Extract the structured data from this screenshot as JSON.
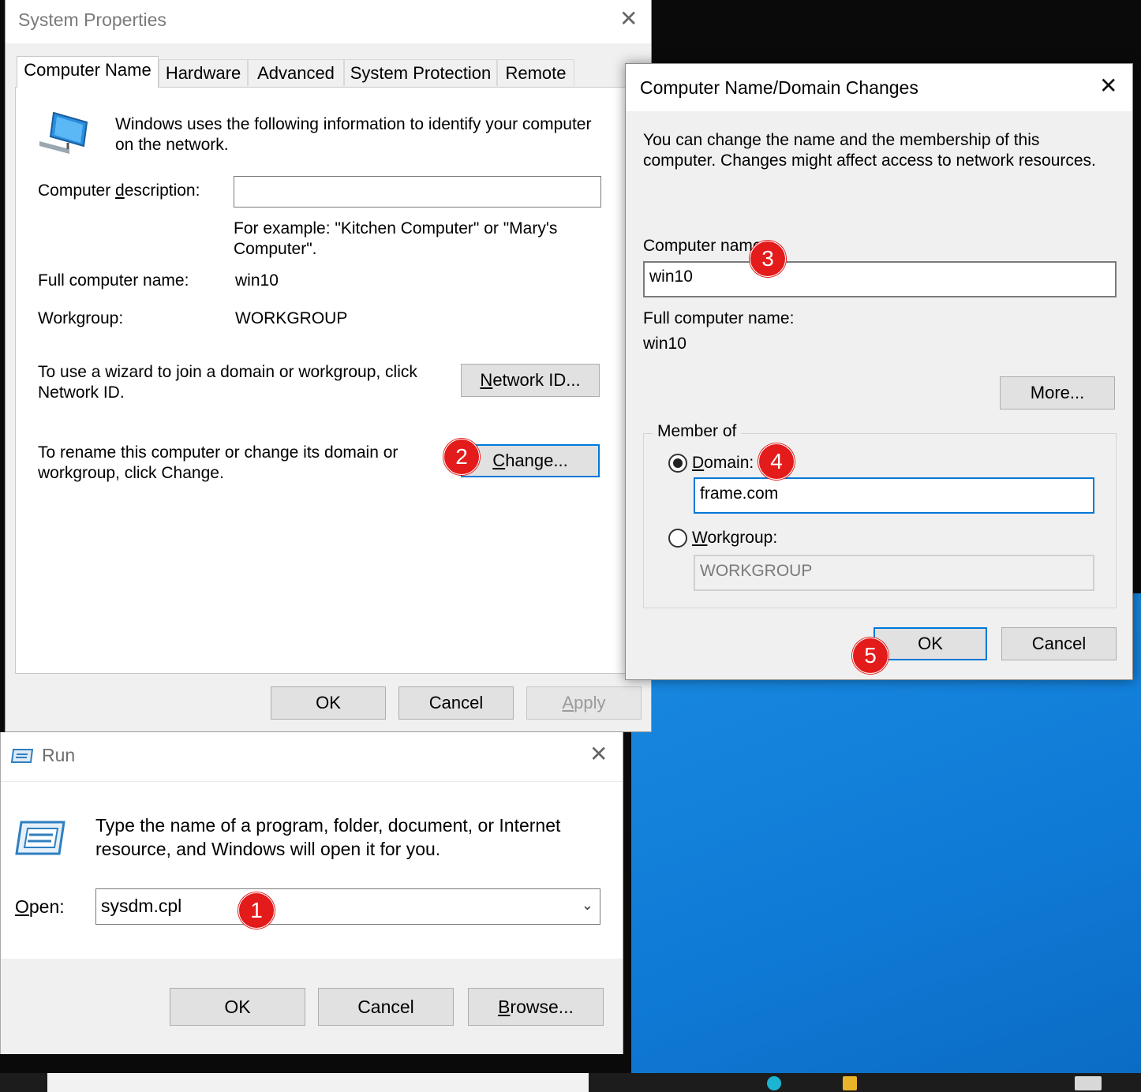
{
  "system_properties": {
    "title": "System Properties",
    "tabs": [
      "Computer Name",
      "Hardware",
      "Advanced",
      "System Protection",
      "Remote"
    ],
    "intro": "Windows uses the following information to identify your computer on the network.",
    "description_label": "Computer description:",
    "description_value": "",
    "example_text": "For example: \"Kitchen Computer\" or \"Mary's Computer\".",
    "full_name_label": "Full computer name:",
    "full_name_value": "win10",
    "workgroup_label": "Workgroup:",
    "workgroup_value": "WORKGROUP",
    "network_id_text": "To use a wizard to join a domain or workgroup, click Network ID.",
    "network_id_button": "Network ID...",
    "change_text": "To rename this computer or change its domain or workgroup, click Change.",
    "change_button": "Change...",
    "ok": "OK",
    "cancel": "Cancel",
    "apply": "Apply"
  },
  "domain_dialog": {
    "title": "Computer Name/Domain Changes",
    "intro": "You can change the name and the membership of this computer. Changes might affect access to network resources.",
    "computer_name_label": "Computer name:",
    "computer_name_value": "win10",
    "full_name_label": "Full computer name:",
    "full_name_value": "win10",
    "more_button": "More...",
    "member_of_label": "Member of",
    "domain_label": "Domain:",
    "domain_value": "frame.com",
    "domain_selected": true,
    "workgroup_label": "Workgroup:",
    "workgroup_value": "WORKGROUP",
    "ok": "OK",
    "cancel": "Cancel"
  },
  "run_dialog": {
    "title": "Run",
    "prompt": "Type the name of a program, folder, document, or Internet resource, and Windows will open it for you.",
    "open_label": "Open:",
    "open_value": "sysdm.cpl",
    "ok": "OK",
    "cancel": "Cancel",
    "browse": "Browse..."
  },
  "badges": [
    "1",
    "2",
    "3",
    "4",
    "5"
  ],
  "colors": {
    "accent": "#0078d7",
    "badge": "#e31b1b",
    "desktop": "#0f7ad6"
  }
}
